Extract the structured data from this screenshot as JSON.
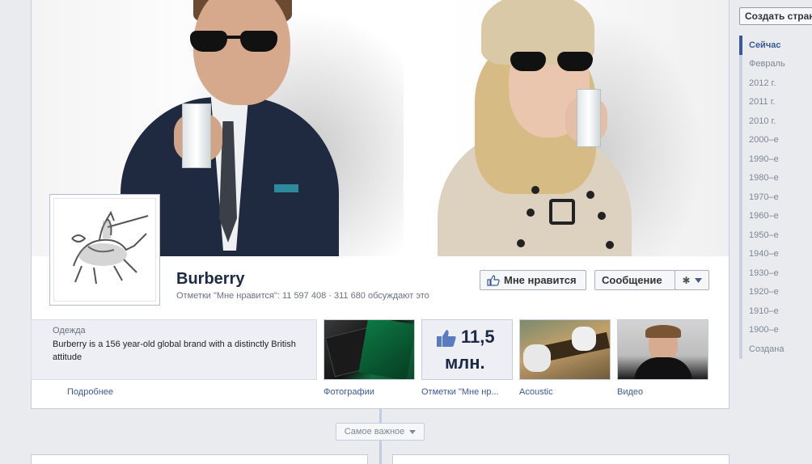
{
  "page": {
    "name": "Burberry",
    "stats": "Отметки \"Мне нравится\": 11 597 408 · 311 680 обсуждают это",
    "category": "Одежда",
    "description": "Burberry is a 156 year-old global brand with a distinctly British attitude",
    "more_link": "Подробнее"
  },
  "actions": {
    "like_label": "Мне нравится",
    "message_label": "Сообщение"
  },
  "tiles": [
    {
      "label": "Фотографии"
    },
    {
      "label": "Отметки \"Мне нр...",
      "number": "11,5",
      "unit": "млн."
    },
    {
      "label": "Acoustic"
    },
    {
      "label": "Видео"
    }
  ],
  "timeline": {
    "highlights_label": "Самое важное"
  },
  "sidebar": {
    "create_label": "Создать стран",
    "years": [
      "Сейчас",
      "Февраль",
      "2012 г.",
      "2011 г.",
      "2010 г.",
      "2000–е",
      "1990–е",
      "1980–е",
      "1970–е",
      "1960–е",
      "1950–е",
      "1940–е",
      "1930–е",
      "1920–е",
      "1910–е",
      "1900–е",
      "Создана"
    ]
  },
  "icons": [
    "thumbs-up-icon",
    "gear-icon",
    "chevron-down-icon",
    "burberry-knight-logo"
  ],
  "colors": {
    "link": "#3b5998",
    "title": "#1c2a47",
    "background": "#e9ebee"
  }
}
